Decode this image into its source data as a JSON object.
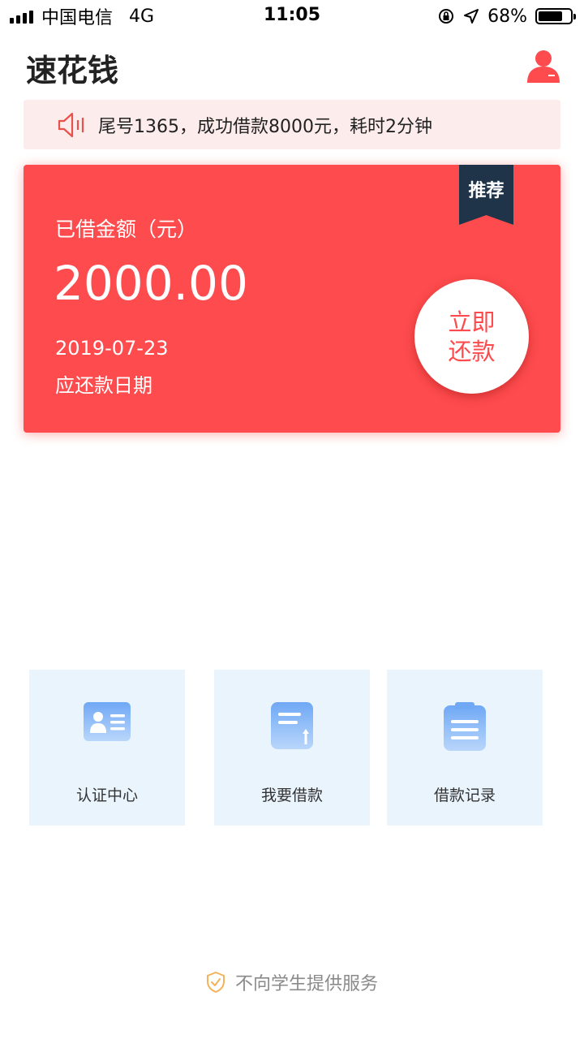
{
  "status_bar": {
    "carrier": "中国电信",
    "network": "4G",
    "time": "11:05",
    "battery": "68%",
    "battery_level": 0.68
  },
  "header": {
    "title": "速花钱",
    "profile_icon": "user-icon"
  },
  "notice": {
    "icon": "speaker-icon",
    "text": "尾号1365，成功借款8000元，耗时2分钟"
  },
  "loan_card": {
    "ribbon": "推荐",
    "label": "已借金额（元）",
    "amount": "2000.00",
    "due_date": "2019-07-23",
    "due_label": "应还款日期",
    "repay_button": "立即还款",
    "color": "#fe4b4d"
  },
  "tiles": [
    {
      "label": "认证中心",
      "icon": "id-card-icon"
    },
    {
      "label": "我要借款",
      "icon": "loan-document-icon"
    },
    {
      "label": "借款记录",
      "icon": "clipboard-icon"
    }
  ],
  "footer": {
    "text": "不向学生提供服务",
    "icon": "shield-check-icon"
  }
}
